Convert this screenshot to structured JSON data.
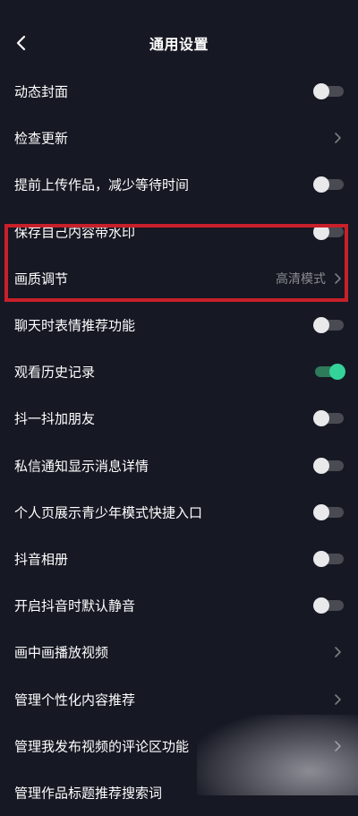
{
  "header": {
    "title": "通用设置"
  },
  "settings": {
    "rows": [
      {
        "label": "动态封面",
        "type": "toggle",
        "on": false
      },
      {
        "label": "检查更新",
        "type": "link"
      },
      {
        "label": "提前上传作品，减少等待时间",
        "type": "toggle",
        "on": false
      },
      {
        "label": "保存自己内容带水印",
        "type": "toggle",
        "on": false
      },
      {
        "label": "画质调节",
        "type": "link",
        "value": "高清模式"
      },
      {
        "label": "聊天时表情推荐功能",
        "type": "toggle",
        "on": false
      },
      {
        "label": "观看历史记录",
        "type": "toggle",
        "on": true
      },
      {
        "label": "抖一抖加朋友",
        "type": "toggle",
        "on": false
      },
      {
        "label": "私信通知显示消息详情",
        "type": "toggle",
        "on": false
      },
      {
        "label": "个人页展示青少年模式快捷入口",
        "type": "toggle",
        "on": false
      },
      {
        "label": "抖音相册",
        "type": "toggle",
        "on": false
      },
      {
        "label": "开启抖音时默认静音",
        "type": "toggle",
        "on": false
      },
      {
        "label": "画中画播放视频",
        "type": "link"
      },
      {
        "label": "管理个性化内容推荐",
        "type": "link"
      },
      {
        "label": "管理我发布视频的评论区功能",
        "type": "link"
      },
      {
        "label": "管理作品标题推荐搜索词",
        "type": "link"
      }
    ]
  },
  "colors": {
    "background": "#161823",
    "toggle_on": "#34d399",
    "highlight_border": "#c8202a"
  }
}
